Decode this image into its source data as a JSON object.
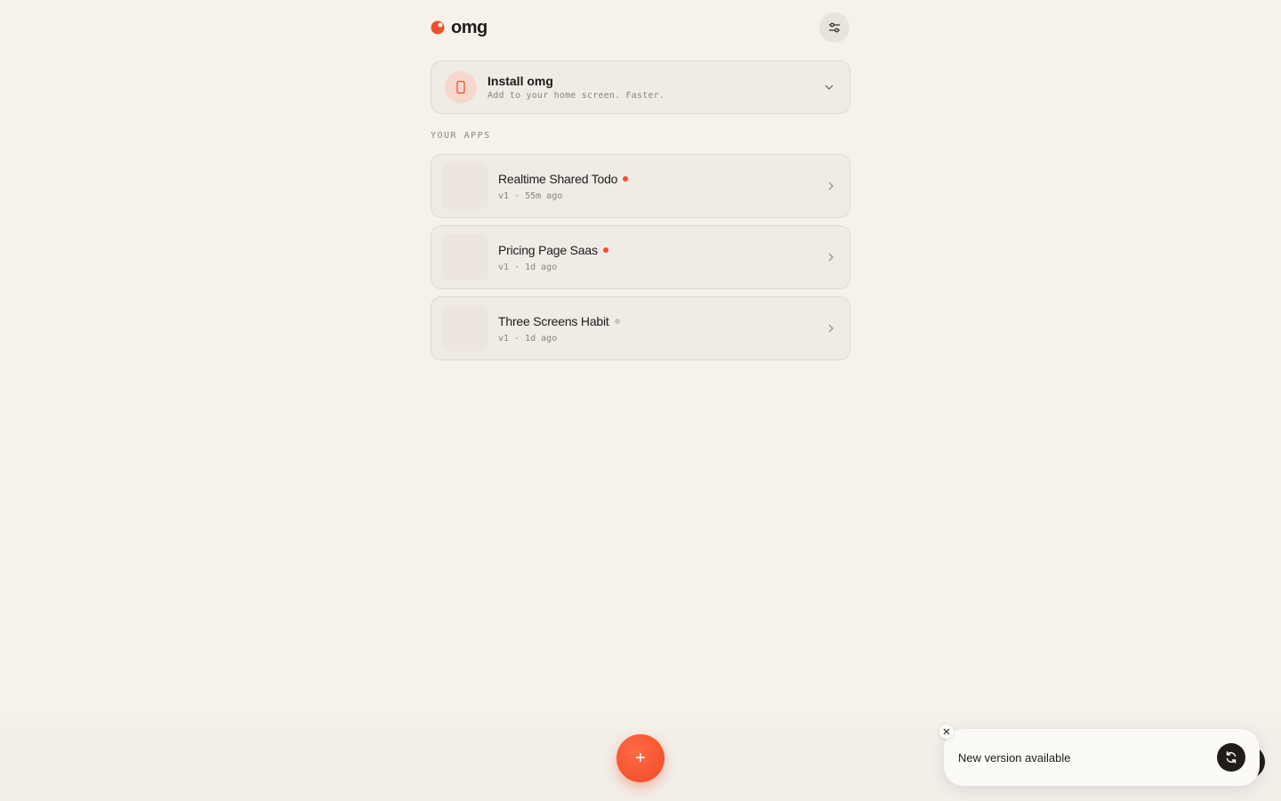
{
  "brand": {
    "name": "omg",
    "accent": "#f0502b"
  },
  "header": {
    "settings_icon": "sliders-icon"
  },
  "install": {
    "title": "Install omg",
    "subtitle": "Add to your home screen. Faster.",
    "icon": "phone-icon"
  },
  "apps": {
    "section_label": "YOUR APPS",
    "items": [
      {
        "title": "Realtime Shared Todo",
        "meta": "v1 · 55m ago",
        "status_color": "#f0502b"
      },
      {
        "title": "Pricing Page Saas",
        "meta": "v1 · 1d ago",
        "status_color": "#f0502b"
      },
      {
        "title": "Three Screens Habit",
        "meta": "v1 · 1d ago",
        "status_color": "#c9c4bd"
      }
    ]
  },
  "fab": {
    "label": "+"
  },
  "toast": {
    "message": "New version available",
    "icon": "refresh-icon"
  }
}
